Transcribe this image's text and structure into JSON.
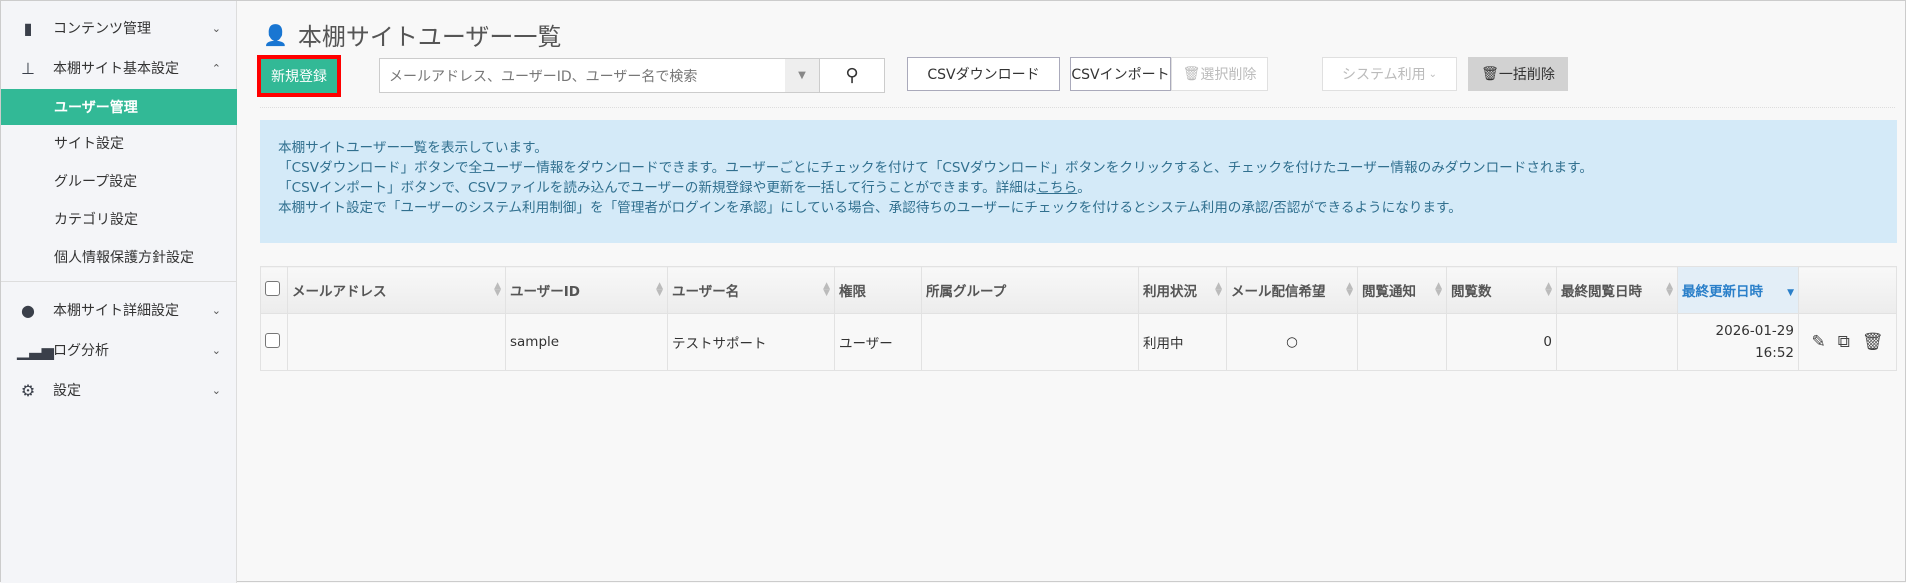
{
  "sidebar": {
    "items": [
      {
        "label": "コンテンツ管理",
        "icon": "book-icon",
        "expanded": false
      },
      {
        "label": "本棚サイト基本設定",
        "icon": "sitemap-icon",
        "expanded": true
      },
      {
        "label": "本棚サイト詳細設定",
        "icon": "globe-icon",
        "expanded": false
      },
      {
        "label": "ログ分析",
        "icon": "bar-chart-icon",
        "expanded": false
      },
      {
        "label": "設定",
        "icon": "gear-icon",
        "expanded": false
      }
    ],
    "sub_items": [
      "ユーザー管理",
      "サイト設定",
      "グループ設定",
      "カテゴリ設定",
      "個人情報保護方針設定"
    ],
    "active_sub": "ユーザー管理"
  },
  "header": {
    "title": "本棚サイトユーザー一覧",
    "icon": "user-icon"
  },
  "toolbar": {
    "new": "新規登録",
    "search_placeholder": "メールアドレス、ユーザーID、ユーザー名で検索",
    "csv_download": "CSVダウンロード",
    "csv_import": "CSVインポート",
    "delete_selected": "選択削除",
    "system_use": "システム利用",
    "bulk_delete": "一括削除"
  },
  "info": {
    "line1": "本棚サイトユーザー一覧を表示しています。",
    "line2": "「CSVダウンロード」ボタンで全ユーザー情報をダウンロードできます。ユーザーごとにチェックを付けて「CSVダウンロード」ボタンをクリックすると、チェックを付けたユーザー情報のみダウンロードされます。",
    "line3": "「CSVインポート」ボタンで、CSVファイルを読み込んでユーザーの新規登録や更新を一括して行うことができます。詳細は",
    "line3_link": "こちら",
    "line3_end": "。",
    "line4": "本棚サイト設定で「ユーザーのシステム利用制御」を「管理者がログインを承認」にしている場合、承認待ちのユーザーにチェックを付けるとシステム利用の承認/否認ができるようになります。"
  },
  "table": {
    "columns": [
      "メールアドレス",
      "ユーザーID",
      "ユーザー名",
      "権限",
      "所属グループ",
      "利用状況",
      "メール配信希望",
      "閲覧通知",
      "閲覧数",
      "最終閲覧日時",
      "最終更新日時"
    ],
    "sorted_column": "最終更新日時",
    "rows": [
      {
        "email": "",
        "user_id": "sample",
        "name": "テストサポート",
        "role": "ユーザー",
        "group": "",
        "status": "利用中",
        "mail": "○",
        "notify": "",
        "views": "0",
        "last_view": "",
        "updated_date": "2026-01-29",
        "updated_time": "16:52"
      }
    ]
  },
  "colors": {
    "accent": "#32b996",
    "highlight": "#ff0000",
    "info_bg": "#d4eaf8"
  }
}
